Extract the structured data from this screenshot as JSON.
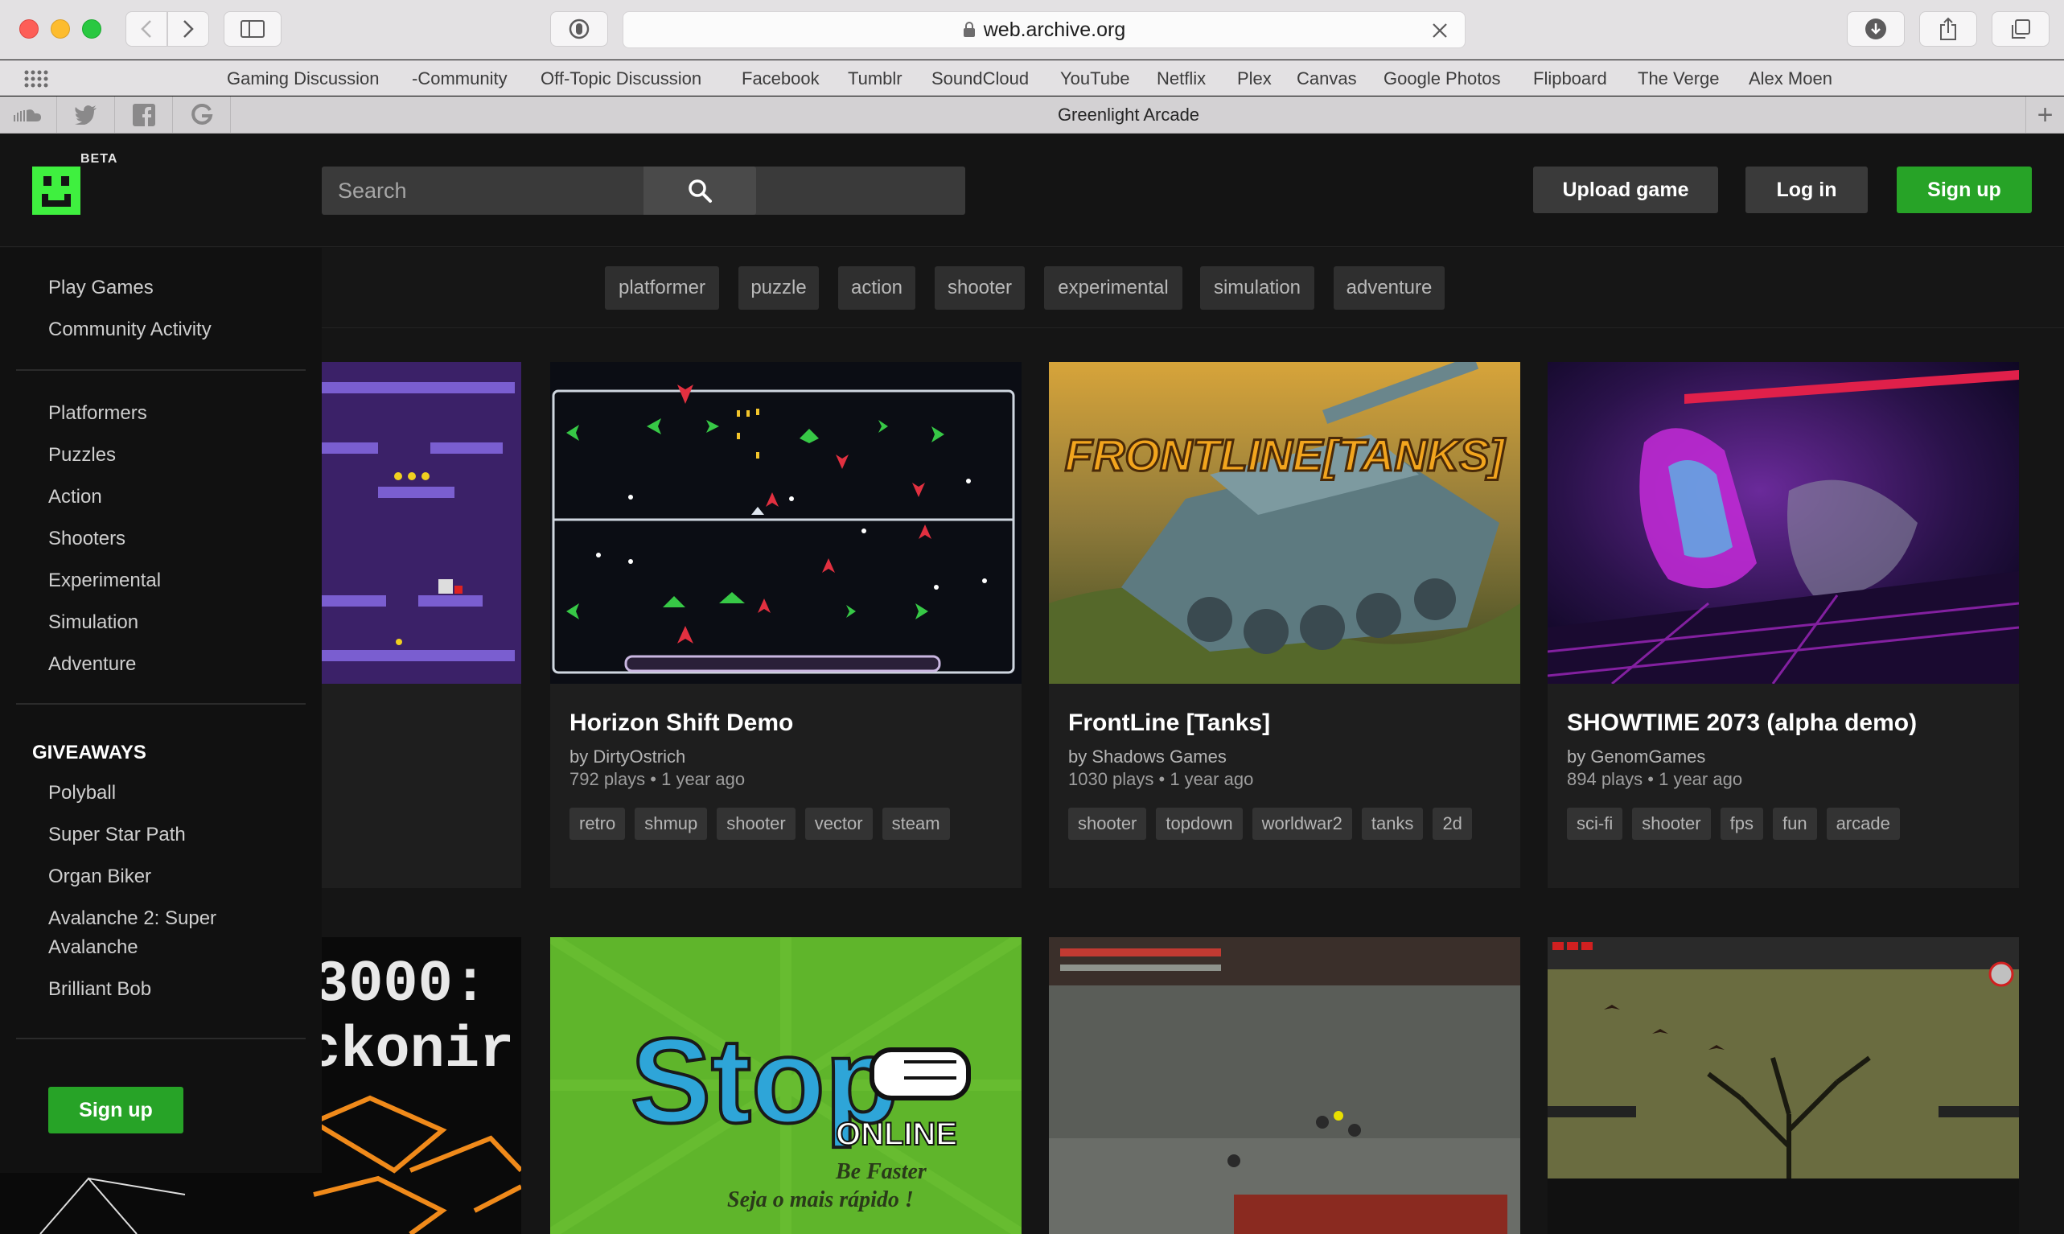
{
  "browser": {
    "url": "web.archive.org",
    "tab_title": "Greenlight Arcade",
    "bookmarks": [
      "Gaming Discussion",
      "-Community",
      "Off-Topic Discussion",
      "Facebook",
      "Tumblr",
      "SoundCloud",
      "YouTube",
      "Netflix",
      "Plex",
      "Canvas",
      "Google Photos",
      "Flipboard",
      "The Verge",
      "Alex Moen"
    ],
    "pinned_tabs": [
      "soundcloud-icon",
      "twitter-icon",
      "facebook-icon",
      "google-icon"
    ]
  },
  "header": {
    "beta_label": "BETA",
    "search_placeholder": "Search",
    "upload_label": "Upload game",
    "login_label": "Log in",
    "signup_label": "Sign up"
  },
  "tags": [
    "platformer",
    "puzzle",
    "action",
    "shooter",
    "experimental",
    "simulation",
    "adventure"
  ],
  "sidebar": {
    "main": [
      "Play Games",
      "Community Activity"
    ],
    "genres": [
      "Platformers",
      "Puzzles",
      "Action",
      "Shooters",
      "Experimental",
      "Simulation",
      "Adventure"
    ],
    "giveaways_heading": "GIVEAWAYS",
    "giveaways": [
      "Polyball",
      "Super Star Path",
      "Organ Biker",
      "Avalanche 2: Super Avalanche",
      "Brilliant Bob"
    ],
    "signup_label": "Sign up"
  },
  "games": [
    {
      "title": "Horizon Shift Demo",
      "author": "by DirtyOstrich",
      "meta": "792 plays • 1 year ago",
      "tags": [
        "retro",
        "shmup",
        "shooter",
        "vector",
        "steam"
      ]
    },
    {
      "title": "FrontLine [Tanks]",
      "author": "by Shadows Games",
      "meta": "1030 plays • 1 year ago",
      "tags": [
        "shooter",
        "topdown",
        "worldwar2",
        "tanks",
        "2d"
      ],
      "thumb_text": "FRONTLINE[TANKS]"
    },
    {
      "title": "SHOWTIME 2073 (alpha demo)",
      "author": "by GenomGames",
      "meta": "894 plays • 1 year ago",
      "tags": [
        "sci-fi",
        "shooter",
        "fps",
        "fun",
        "arcade"
      ]
    }
  ],
  "row2_thumbs": {
    "left_text_top": "3000:",
    "left_text_bottom": "ckonir",
    "stop_title": "Stop",
    "stop_sub": "ONLINE",
    "stop_line1": "Be Faster",
    "stop_line2": "Seja o mais rápido !"
  },
  "colors": {
    "brand_green": "#27a327",
    "logo_green": "#3ff03f",
    "page_bg": "#151515"
  }
}
